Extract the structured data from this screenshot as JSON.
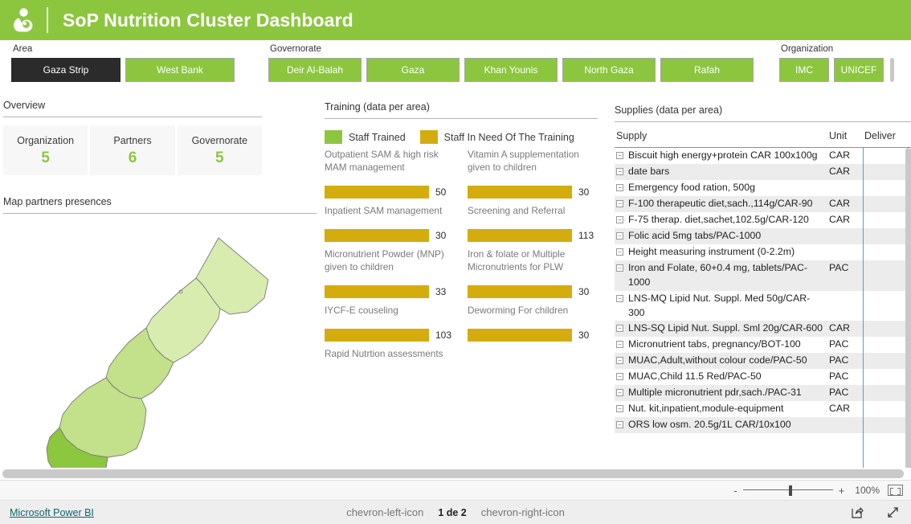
{
  "header": {
    "title": "SoP Nutrition Cluster Dashboard",
    "logo_icon": "breastfeeding-mother-icon",
    "brand_green": "#8CC63F"
  },
  "slicers": {
    "area": {
      "label": "Area",
      "selected": "Gaza Strip",
      "options": [
        "Gaza Strip",
        "West Bank"
      ]
    },
    "governorate": {
      "label": "Governorate",
      "options": [
        "Deir Al-Balah",
        "Gaza",
        "Khan Younis",
        "North Gaza",
        "Rafah"
      ]
    },
    "organization": {
      "label": "Organization",
      "options": [
        "IMC",
        "UNICEF"
      ]
    }
  },
  "overview": {
    "title": "Overview",
    "kpis": [
      {
        "label": "Organization",
        "value": "5"
      },
      {
        "label": "Partners",
        "value": "6"
      },
      {
        "label": "Governorate",
        "value": "5"
      }
    ]
  },
  "map": {
    "title": "Map partners presences",
    "region": "Gaza Strip",
    "fill_light": "#d8ecb0",
    "fill_mid": "#c3e08a",
    "fill_dark": "#8dc63f"
  },
  "training": {
    "title": "Training (data per area)",
    "legend": [
      {
        "label": "Staff Trained",
        "color": "#8CC63F"
      },
      {
        "label": "Staff In Need Of The Training",
        "color": "#D4AC0D"
      }
    ]
  },
  "supplies": {
    "title": "Supplies (data per area)",
    "columns": [
      "Supply",
      "Unit",
      "Deliver"
    ],
    "rows": [
      {
        "supply": "Biscuit high energy+protein CAR 100x100g",
        "unit": "CAR",
        "deliver": ""
      },
      {
        "supply": "date bars",
        "unit": "CAR",
        "deliver": ""
      },
      {
        "supply": "Emergency food ration, 500g",
        "unit": "",
        "deliver": ""
      },
      {
        "supply": "F-100 therapeutic diet,sach.,114g/CAR-90",
        "unit": "CAR",
        "deliver": ""
      },
      {
        "supply": "F-75 therap. diet,sachet,102.5g/CAR-120",
        "unit": "CAR",
        "deliver": ""
      },
      {
        "supply": "Folic acid 5mg tabs/PAC-1000",
        "unit": "",
        "deliver": ""
      },
      {
        "supply": "Height measuring instrument (0-2.2m)",
        "unit": "",
        "deliver": ""
      },
      {
        "supply": "Iron and Folate, 60+0.4 mg, tablets/PAC-1000",
        "unit": "PAC",
        "deliver": ""
      },
      {
        "supply": "LNS-MQ Lipid Nut. Suppl. Med 50g/CAR-300",
        "unit": "",
        "deliver": ""
      },
      {
        "supply": "LNS-SQ Lipid Nut. Suppl. Sml 20g/CAR-600",
        "unit": "CAR",
        "deliver": ""
      },
      {
        "supply": "Micronutrient tabs, pregnancy/BOT-100",
        "unit": "PAC",
        "deliver": ""
      },
      {
        "supply": "MUAC,Adult,without colour code/PAC-50",
        "unit": "PAC",
        "deliver": ""
      },
      {
        "supply": "MUAC,Child 11.5 Red/PAC-50",
        "unit": "PAC",
        "deliver": ""
      },
      {
        "supply": "Multiple micronutrient pdr,sach./PAC-31",
        "unit": "PAC",
        "deliver": ""
      },
      {
        "supply": "Nut. kit,inpatient,module-equipment",
        "unit": "CAR",
        "deliver": ""
      },
      {
        "supply": "ORS low osm. 20.5g/1L CAR/10x100",
        "unit": "",
        "deliver": ""
      }
    ]
  },
  "statusbar": {
    "zoom_minus": "-",
    "zoom_plus": "+",
    "zoom_level": "100%",
    "fit_icon": "fit-to-page-icon"
  },
  "footer": {
    "brand_link": "Microsoft Power BI",
    "prev_icon": "chevron-left-icon",
    "next_icon": "chevron-right-icon",
    "page_text": "1 de 2",
    "share_icon": "share-icon",
    "fullscreen_icon": "fullscreen-icon"
  },
  "chart_data": {
    "type": "bar",
    "title": "Training (data per area)",
    "xlabel": "",
    "ylabel": "",
    "orientation": "horizontal",
    "stacked": true,
    "legend_position": "top",
    "grid": false,
    "categories": [
      "Outpatient SAM & high risk MAM management",
      "Vitamin A supplementation given to children",
      "Inpatient SAM management",
      "Screening and Referral",
      "Micronutrient Powder (MNP) given to children",
      "Iron & folate or Multiple Micronutrients for PLW",
      "IYCF-E couseling",
      "Deworming For children",
      "Rapid Nutrtion assessments"
    ],
    "series": [
      {
        "name": "Staff Trained",
        "color": "#8CC63F",
        "values": [
          0,
          0,
          0,
          0,
          0,
          0,
          0,
          0,
          null
        ]
      },
      {
        "name": "Staff In Need Of The Training",
        "color": "#D4AC0D",
        "values": [
          50,
          30,
          30,
          113,
          33,
          30,
          103,
          30,
          null
        ]
      }
    ],
    "data_labels": [
      "50",
      "30",
      "30",
      "113",
      "33",
      "30",
      "103",
      "30",
      ""
    ],
    "notes": "All visible bars are fully 'Staff In Need Of The Training' (gold); no green 'Staff Trained' segment is rendered. The last category 'Rapid Nutrtion assessments' label is visible but its bar is clipped below the visible area."
  }
}
